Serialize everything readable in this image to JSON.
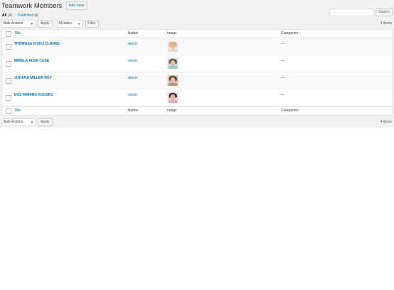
{
  "header": {
    "title": "Teamwork Members",
    "add_new": "Add New"
  },
  "views": {
    "all_label": "All",
    "all_count": "(4)",
    "sep": "|",
    "published_label": "Published",
    "published_count": "(4)"
  },
  "search": {
    "button": "Search"
  },
  "tablenav_top": {
    "bulk_actions": "Bulk Actions",
    "apply": "Apply",
    "dates": "All dates",
    "filter": "Filter",
    "items": "4 items"
  },
  "table": {
    "columns": {
      "title": "Title",
      "author": "Author",
      "image": "Image",
      "categories": "Categories"
    },
    "rows": [
      {
        "title": "THOMASA KISKU CLARKE",
        "author": "admin",
        "categories": "—",
        "thumb": {
          "sky": "#f3ece6",
          "hair": "#d9b07a",
          "body": "#e9d8c9"
        }
      },
      {
        "title": "MIRELA ALBA CUSE",
        "author": "admin",
        "categories": "—",
        "thumb": {
          "sky": "#bfe3e6",
          "hair": "#6b4a3a",
          "body": "#9cc7c9"
        }
      },
      {
        "title": "JOHANA MILLER ROY",
        "author": "admin",
        "categories": "—",
        "thumb": {
          "sky": "#d7c3b4",
          "hair": "#5a3a2a",
          "body": "#b59480"
        }
      },
      {
        "title": "DAS MARINA KOUSKU",
        "author": "admin",
        "categories": "—",
        "thumb": {
          "sky": "#efd4da",
          "hair": "#3a2a2a",
          "body": "#e7a9b5"
        }
      }
    ]
  },
  "tablenav_bottom": {
    "bulk_actions": "Bulk Actions",
    "apply": "Apply",
    "items": "4 items"
  }
}
